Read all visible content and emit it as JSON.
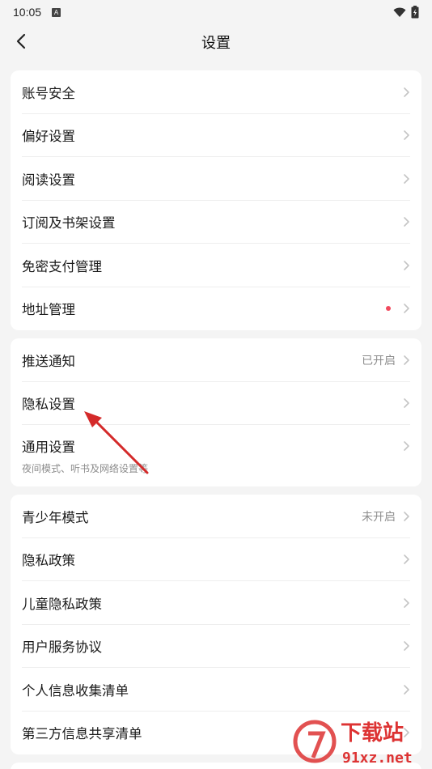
{
  "status": {
    "time": "10:05",
    "notif_letter": "A"
  },
  "nav": {
    "title": "设置"
  },
  "groups": [
    {
      "items": [
        {
          "label": "账号安全"
        },
        {
          "label": "偏好设置"
        },
        {
          "label": "阅读设置"
        },
        {
          "label": "订阅及书架设置"
        },
        {
          "label": "免密支付管理"
        },
        {
          "label": "地址管理",
          "badge": "red-dot"
        }
      ]
    },
    {
      "items": [
        {
          "label": "推送通知",
          "value": "已开启"
        },
        {
          "label": "隐私设置"
        },
        {
          "label": "通用设置",
          "sub": "夜间模式、听书及网络设置等"
        }
      ]
    },
    {
      "items": [
        {
          "label": "青少年模式",
          "value": "未开启"
        },
        {
          "label": "隐私政策"
        },
        {
          "label": "儿童隐私政策"
        },
        {
          "label": "用户服务协议"
        },
        {
          "label": "个人信息收集清单"
        },
        {
          "label": "第三方信息共享清单"
        }
      ]
    }
  ],
  "watermark": {
    "line1": "下载站",
    "line2": "91xz.net"
  },
  "colors": {
    "accent_red": "#f14a5e",
    "annotation_arrow": "#d42a2a",
    "background": "#f4f4f4"
  },
  "icons": {
    "back": "chevron-left-icon",
    "row": "chevron-right-icon",
    "wifi": "wifi-icon",
    "battery": "battery-icon"
  }
}
